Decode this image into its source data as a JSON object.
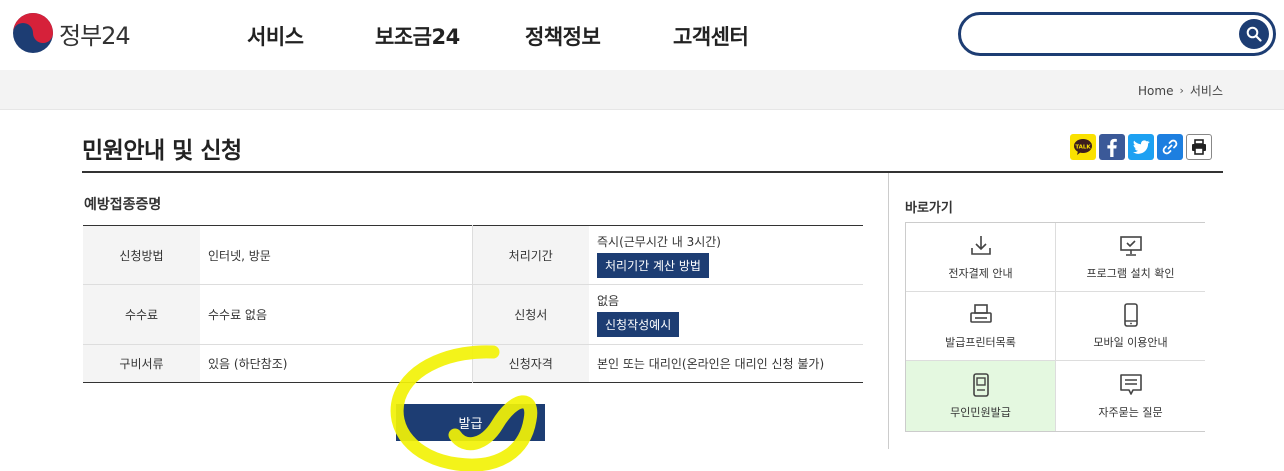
{
  "header": {
    "logo_text": "정부24",
    "nav": [
      "서비스",
      "보조금24",
      "정책정보",
      "고객센터"
    ],
    "search": {
      "value": "",
      "placeholder": ""
    }
  },
  "breadcrumb": {
    "home": "Home",
    "current": "서비스"
  },
  "page": {
    "title": "민원안내 및 신청"
  },
  "share": [
    "kakaotalk-icon",
    "facebook-icon",
    "twitter-icon",
    "link-icon",
    "print-icon"
  ],
  "section": {
    "title": "예방접종증명"
  },
  "table": {
    "row1": {
      "h1": "신청방법",
      "v1": "인터넷, 방문",
      "h2": "처리기간",
      "v2": "즉시(근무시간 내 3시간)",
      "btn": "처리기간 계산 방법"
    },
    "row2": {
      "h1": "수수료",
      "v1": "수수료 없음",
      "h2": "신청서",
      "v2": "없음",
      "btn": "신청작성예시"
    },
    "row3": {
      "h1": "구비서류",
      "v1": "있음 (하단참조)",
      "h2": "신청자격",
      "v2": "본인 또는 대리인(온라인은 대리인 신청 불가)"
    }
  },
  "issue_button": "발급",
  "quick": {
    "title": "바로가기",
    "items": [
      {
        "label": "전자결제 안내",
        "icon": "download-icon"
      },
      {
        "label": "프로그램 설치 확인",
        "icon": "monitor-icon"
      },
      {
        "label": "발급프린터목록",
        "icon": "printer-icon"
      },
      {
        "label": "모바일 이용안내",
        "icon": "mobile-icon"
      },
      {
        "label": "무인민원발급",
        "icon": "kiosk-icon"
      },
      {
        "label": "자주묻는 질문",
        "icon": "faq-icon"
      }
    ]
  },
  "colors": {
    "brand_navy": "#1d3d73",
    "highlight_yellow": "#f2f207",
    "kakao_yellow": "#fae100",
    "facebook_blue": "#3b5998",
    "twitter_blue": "#1da1f2",
    "quick_active_bg": "#e4f8e0"
  }
}
